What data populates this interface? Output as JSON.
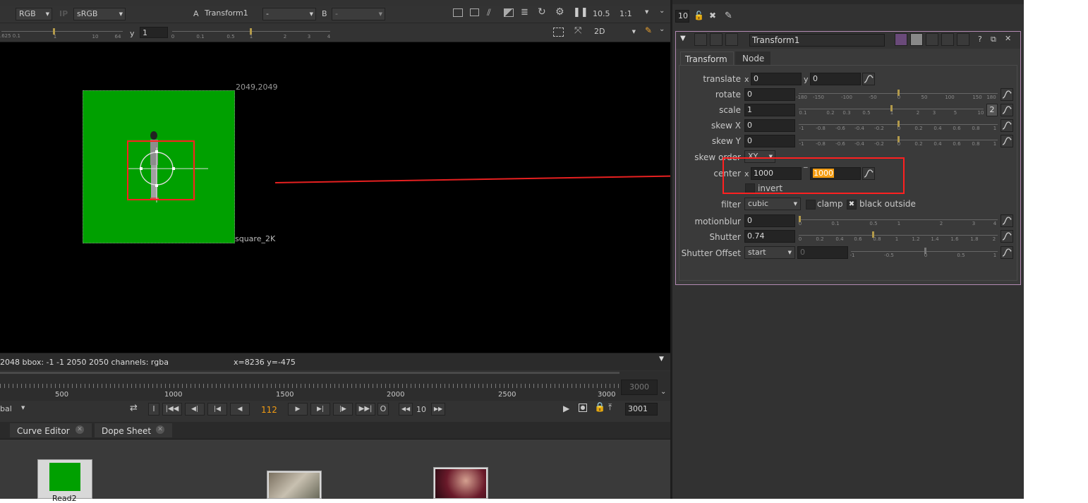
{
  "viewer_toolbar": {
    "channels": "RGB",
    "ip_label": "IP",
    "colorspace": "sRGB",
    "input_a_label": "A",
    "input_a_node": "Transform1",
    "merge_op": "-",
    "input_b_label": "B",
    "input_b_node": "-",
    "fstop": "10.5",
    "zoom": "1:1",
    "gain_lo": ".625 0.1",
    "gain_ticks": [
      "1",
      "10",
      "64"
    ],
    "y_label": "y",
    "y_value": "1",
    "gamma_ticks": [
      "0",
      "0.1",
      "0.5",
      "1",
      "2",
      "3",
      "4"
    ],
    "view_mode": "2D"
  },
  "viewer": {
    "format_corner": "2049,2049",
    "format_name": "square_2K",
    "status_text": "2048  bbox: -1 -1 2050 2050 channels: rgba",
    "coords_text": "x=8236 y=-475"
  },
  "timeline": {
    "ticks": [
      "500",
      "1000",
      "1500",
      "2000",
      "2500",
      "3000"
    ],
    "end_frame": "3000",
    "mode_label": "bal",
    "current_frame": "112",
    "step": "10",
    "out_frame": "3001"
  },
  "bottom_tabs": [
    {
      "label": "Curve Editor"
    },
    {
      "label": "Dope Sheet"
    }
  ],
  "node_graph": {
    "node1_label": "Read2"
  },
  "properties_bin": {
    "max_panels": "10",
    "panel_title": "Transform1",
    "tabs": [
      "Transform",
      "Node"
    ],
    "translate_label": "translate",
    "translate_x_axis": "x",
    "translate_x": "0",
    "translate_y_axis": "y",
    "translate_y": "0",
    "rotate_label": "rotate",
    "rotate_value": "0",
    "rotate_ticks": [
      "-180",
      "-150",
      "-100",
      "-50",
      "0",
      "50",
      "100",
      "150",
      "180"
    ],
    "scale_label": "scale",
    "scale_value": "1",
    "scale_ticks": [
      "0.1",
      "0.2",
      "0.3",
      "0.5",
      "1",
      "2",
      "3",
      "5",
      "10"
    ],
    "scale_split": "2",
    "skewx_label": "skew X",
    "skewx_value": "0",
    "skew_ticks": [
      "-1",
      "-0.8",
      "-0.6",
      "-0.4",
      "-0.2",
      "0",
      "0.2",
      "0.4",
      "0.6",
      "0.8",
      "1"
    ],
    "skewy_label": "skew Y",
    "skewy_value": "0",
    "skeworder_label": "skew order",
    "skeworder_value": "XY",
    "center_label": "center",
    "center_x_axis": "x",
    "center_x": "1000",
    "center_y": "1000",
    "invert_label": "invert",
    "filter_label": "filter",
    "filter_value": "cubic",
    "clamp_label": "clamp",
    "black_outside_label": "black outside",
    "motionblur_label": "motionblur",
    "motionblur_value": "0",
    "motionblur_ticks": [
      "0",
      "0.1",
      "0.5",
      "1",
      "2",
      "3",
      "4"
    ],
    "shutter_label": "Shutter",
    "shutter_value": "0.74",
    "shutter_ticks": [
      "0",
      "0.2",
      "0.4",
      "0.6",
      "0.8",
      "1",
      "1.2",
      "1.4",
      "1.6",
      "1.8",
      "2"
    ],
    "shutter_offset_label": "Shutter Offset",
    "shutter_offset_value": "start",
    "shutter_offset_num": "0",
    "shutter_offset_ticks": [
      "-1",
      "-0.5",
      "0",
      "0.5",
      "1"
    ]
  },
  "colors": {
    "panel_bg": "#323232",
    "viewer_bg": "#000000",
    "green_plate": "#00a000",
    "highlight_red": "#ff2020",
    "accent_orange": "#f39c12"
  }
}
